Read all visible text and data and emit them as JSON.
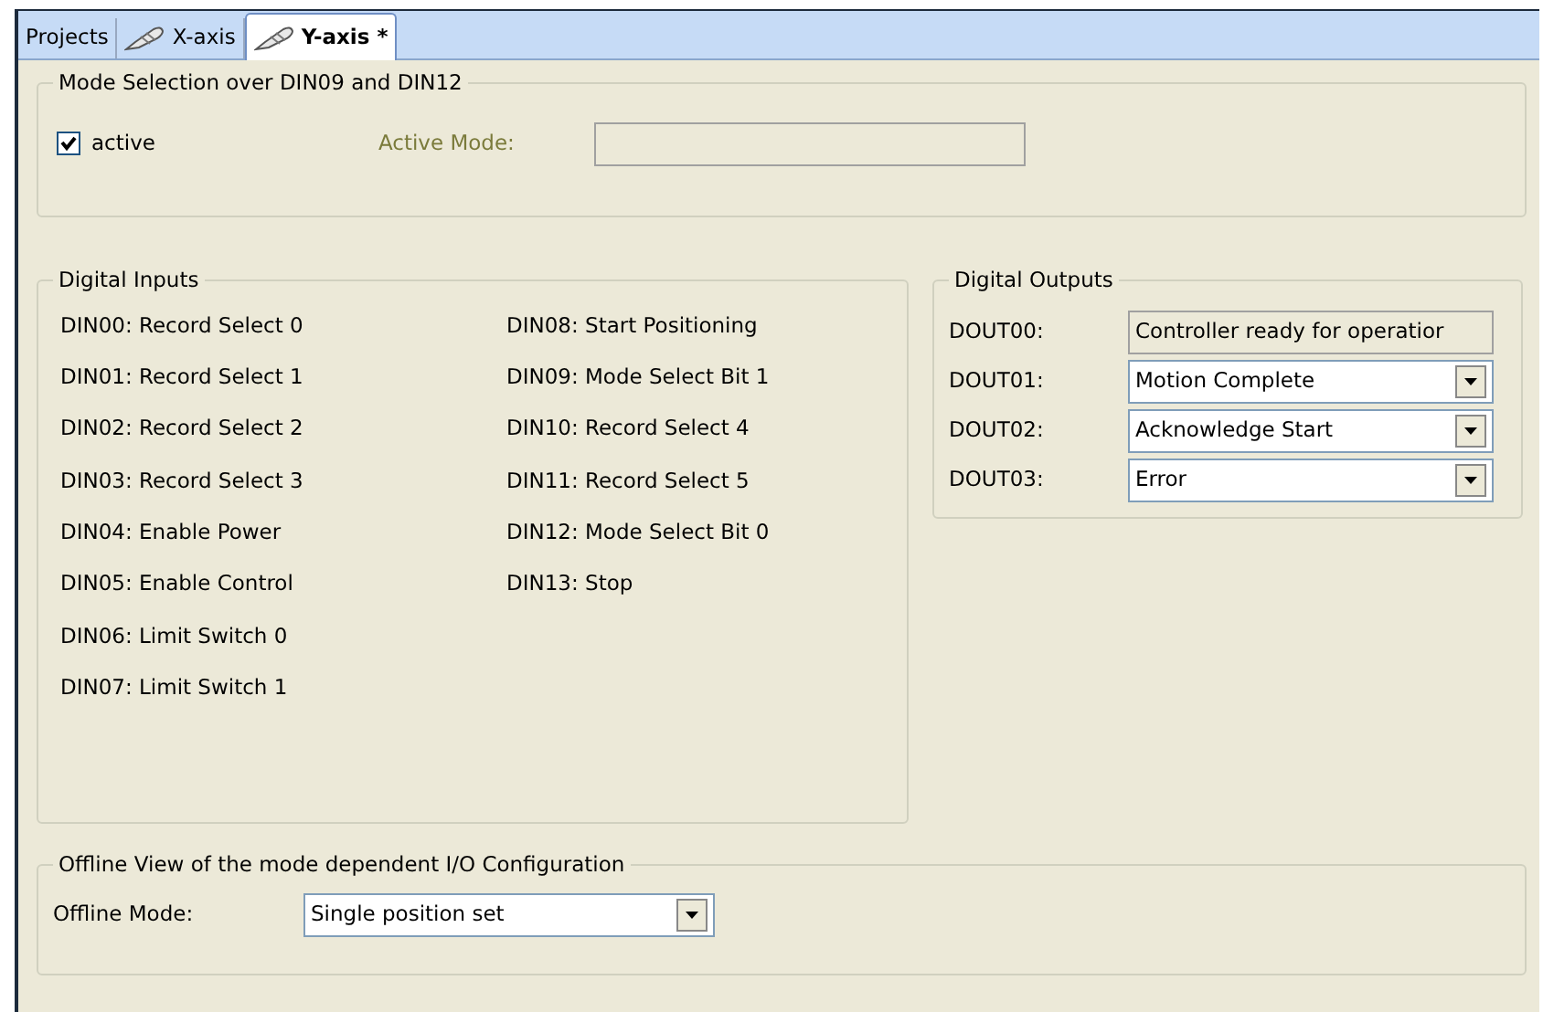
{
  "tabs": [
    {
      "label": "Projects",
      "has_icon": false,
      "selected": false
    },
    {
      "label": "X-axis",
      "has_icon": true,
      "selected": false
    },
    {
      "label": "Y-axis *",
      "has_icon": true,
      "selected": true
    }
  ],
  "mode_selection": {
    "title": "Mode Selection over DIN09 and DIN12",
    "checkbox": {
      "label": "active",
      "checked": true
    },
    "active_mode": {
      "label": "Active Mode:",
      "disabled": true
    }
  },
  "digital_inputs": {
    "title": "Digital Inputs",
    "columns": [
      [
        "DIN00: Record Select 0",
        "DIN01: Record Select 1",
        "DIN02: Record Select 2",
        "DIN03: Record Select 3",
        "DIN04: Enable Power",
        "DIN05: Enable Control",
        "DIN06: Limit Switch 0",
        "DIN07: Limit Switch 1"
      ],
      [
        "DIN08: Start Positioning",
        "DIN09: Mode Select Bit 1",
        "DIN10: Record Select 4",
        "DIN11: Record Select 5",
        "DIN12: Mode Select Bit 0",
        "DIN13: Stop"
      ]
    ]
  },
  "digital_outputs": {
    "title": "Digital Outputs",
    "rows": [
      {
        "label": "DOUT00:",
        "value": "Controller ready for operatior",
        "kind": "readonly"
      },
      {
        "label": "DOUT01:",
        "value": "Motion Complete",
        "kind": "dropdown"
      },
      {
        "label": "DOUT02:",
        "value": "Acknowledge Start",
        "kind": "dropdown"
      },
      {
        "label": "DOUT03:",
        "value": "Error",
        "kind": "dropdown"
      }
    ]
  },
  "offline_view": {
    "title": "Offline View of the mode dependent I/O Configuration",
    "label": "Offline Mode:",
    "value": "Single position set"
  }
}
